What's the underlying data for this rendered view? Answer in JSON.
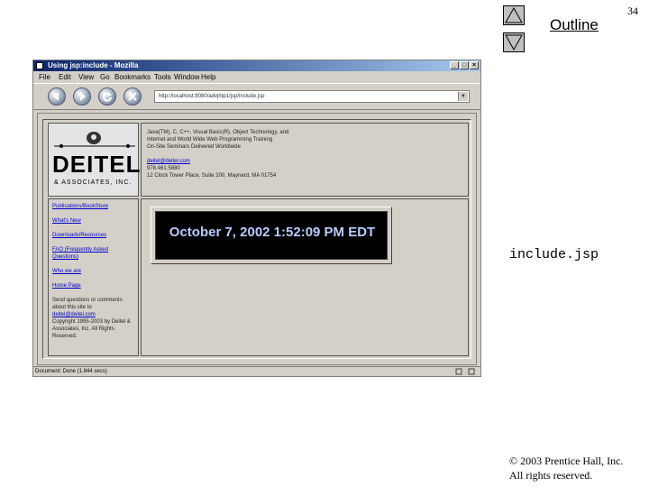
{
  "slide": {
    "page_number": "34",
    "outline_label": "Outline",
    "file_label": "include.jsp",
    "copyright_line1": "© 2003 Prentice Hall, Inc.",
    "copyright_line2": "All rights reserved.",
    "nav_up_icon": "triangle-up-icon",
    "nav_down_icon": "triangle-down-icon"
  },
  "browser": {
    "title": "Using jsp:include - Mozilla",
    "window_buttons": [
      "_",
      "□",
      "×"
    ],
    "menu": [
      "File",
      "Edit",
      "View",
      "Go",
      "Bookmarks",
      "Tools",
      "Window",
      "Help"
    ],
    "url": "http://localhost:8080/advjhtp1/jsp/include.jsp",
    "status": "Document: Done (1.844 secs)",
    "toolbar_icons": [
      "back-icon",
      "forward-icon",
      "reload-icon",
      "stop-icon"
    ]
  },
  "page": {
    "logo_word": "DEITEL",
    "logo_sub": "& ASSOCIATES, INC.",
    "info_lines": [
      "Java(TM), C, C++, Visual Basic(R), Object Technology, and",
      "Internet and World Wide Web Programming Training",
      "On-Site Seminars Delivered Worldwide"
    ],
    "email": "deitel@deitel.com",
    "phone": "978.461.5880",
    "address": "12 Clock Tower Place, Suite 200, Maynard, MA 01754",
    "nav_links": [
      "Publications/BookStore",
      "What's New",
      "Downloads/Resources",
      "FAQ (Frequently Asked Questions)",
      "Who we are",
      "Home Page"
    ],
    "send_text": "Send questions or comments about this site to",
    "send_email": "deitel@deitel.com",
    "copyright_text": "Copyright 1995-2003 by Deitel & Associates, Inc. All Rights Reserved.",
    "date_time": "October 7, 2002 1:52:09 PM EDT"
  }
}
